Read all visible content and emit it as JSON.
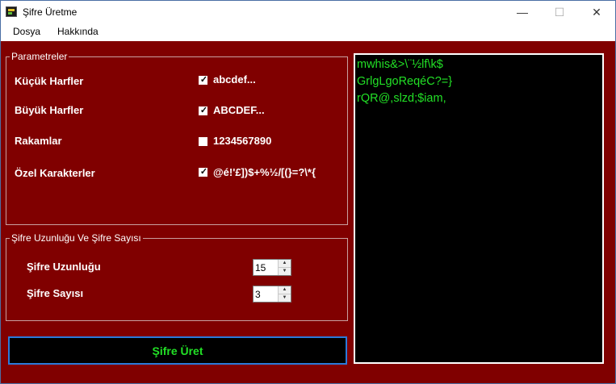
{
  "window": {
    "title": "Şifre Üretme",
    "minimize": "—",
    "maximize": "☐",
    "close": "✕"
  },
  "menu": {
    "items": [
      {
        "label": "Dosya"
      },
      {
        "label": "Hakkında"
      }
    ]
  },
  "params": {
    "legend": "Parametreler",
    "rows": [
      {
        "label": "Küçük Harfler",
        "checked": true,
        "sample": "abcdef..."
      },
      {
        "label": "Büyük Harfler",
        "checked": true,
        "sample": "ABCDEF..."
      },
      {
        "label": "Rakamlar",
        "checked": false,
        "sample": "1234567890"
      },
      {
        "label": "Özel Karakterler",
        "checked": true,
        "sample": "@é!'£])$+%½/[(}=?\\*{"
      }
    ]
  },
  "length_group": {
    "legend": "Şifre Uzunluğu Ve Şifre Sayısı",
    "length_label": "Şifre Uzunluğu",
    "length_value": "15",
    "count_label": "Şifre Sayısı",
    "count_value": "3"
  },
  "generate_button": "Şifre Üret",
  "output": {
    "lines": [
      "mwhis&>\\¨½lf\\k$",
      "GrlgLgoReqéC?=}",
      "rQR@,slzd;$iam,"
    ]
  },
  "colors": {
    "background": "#800000",
    "text_green": "#22e026",
    "output_bg": "#000000"
  }
}
